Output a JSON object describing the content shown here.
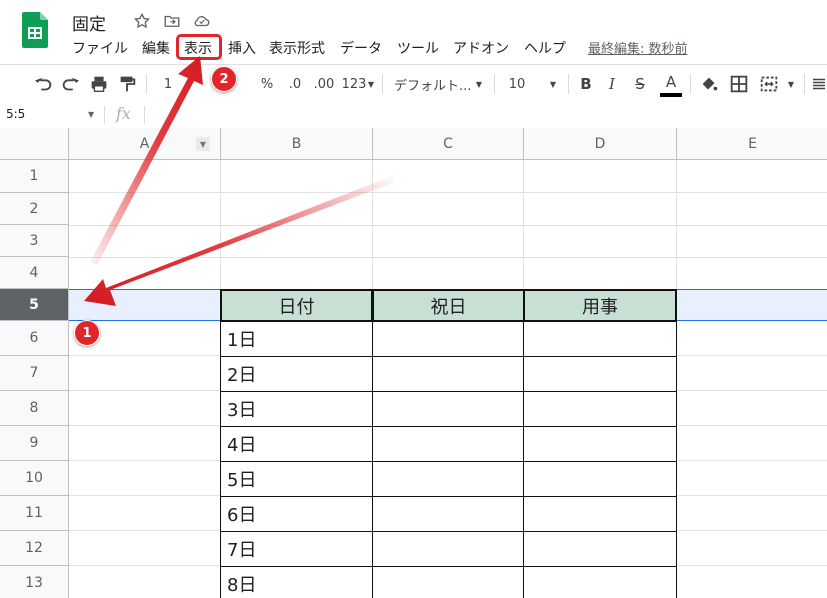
{
  "doc": {
    "title": "固定",
    "last_edit": "最終編集: 数秒前"
  },
  "menu": [
    "ファイル",
    "編集",
    "表示",
    "挿入",
    "表示形式",
    "データ",
    "ツール",
    "アドオン",
    "ヘルプ"
  ],
  "toolbar": {
    "percent": "%",
    "dec_less": ".0",
    "dec_more": ".00",
    "number_format": "123",
    "font": "デフォルト...",
    "font_size": "10",
    "bold": "B",
    "italic": "I",
    "strike": "S",
    "text_color": "A",
    "zoom_partial": "1"
  },
  "formula_bar": {
    "name_box": "5:5",
    "fx": "fx"
  },
  "columns": [
    "A",
    "B",
    "C",
    "D",
    "E"
  ],
  "rows": [
    "1",
    "2",
    "3",
    "4",
    "5",
    "6",
    "7",
    "8",
    "9",
    "10",
    "11",
    "12",
    "13"
  ],
  "table": {
    "headers": [
      "日付",
      "祝日",
      "用事"
    ],
    "dates": [
      "1日",
      "2日",
      "3日",
      "4日",
      "5日",
      "6日",
      "7日",
      "8日"
    ]
  },
  "annotations": {
    "badge1": "1",
    "badge2": "2"
  },
  "colors": {
    "accent": "#1a73e8",
    "header_fill": "#c8e0d4",
    "annotation": "#e0262a",
    "sheets_green": "#0f9d58"
  }
}
